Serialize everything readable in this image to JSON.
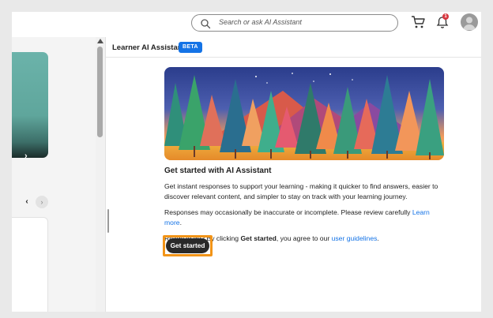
{
  "header": {
    "search_placeholder": "Search or ask AI Assistant",
    "notification_count": "1",
    "icons": [
      "search-icon",
      "cart-icon",
      "bell-icon",
      "avatar"
    ]
  },
  "left_pane": {
    "card_chevron": "›",
    "pager_prev": "‹",
    "pager_next": "›"
  },
  "panel": {
    "title": "Learner AI Assistant",
    "badge": "BETA",
    "heading": "Get started with AI Assistant",
    "intro": "Get instant responses to support your learning - making it quicker to find answers, easier to discover relevant content, and simpler to stay on track with your learning journey.",
    "disclaimer_prefix": "Responses may occasionally be inaccurate or incomplete. Please review carefully ",
    "disclaimer_link": "Learn more",
    "disclaimer_suffix": ".",
    "consent_prefix": "Ready to try? By clicking ",
    "consent_bold": "Get started",
    "consent_middle": ", you agree to our ",
    "consent_link": "user guidelines",
    "consent_suffix": ".",
    "cta_label": "Get started"
  },
  "colors": {
    "accent": "#1473e6",
    "highlight_outline": "#f29418",
    "cta_background": "#292929",
    "notification_badge": "#d7373f"
  }
}
